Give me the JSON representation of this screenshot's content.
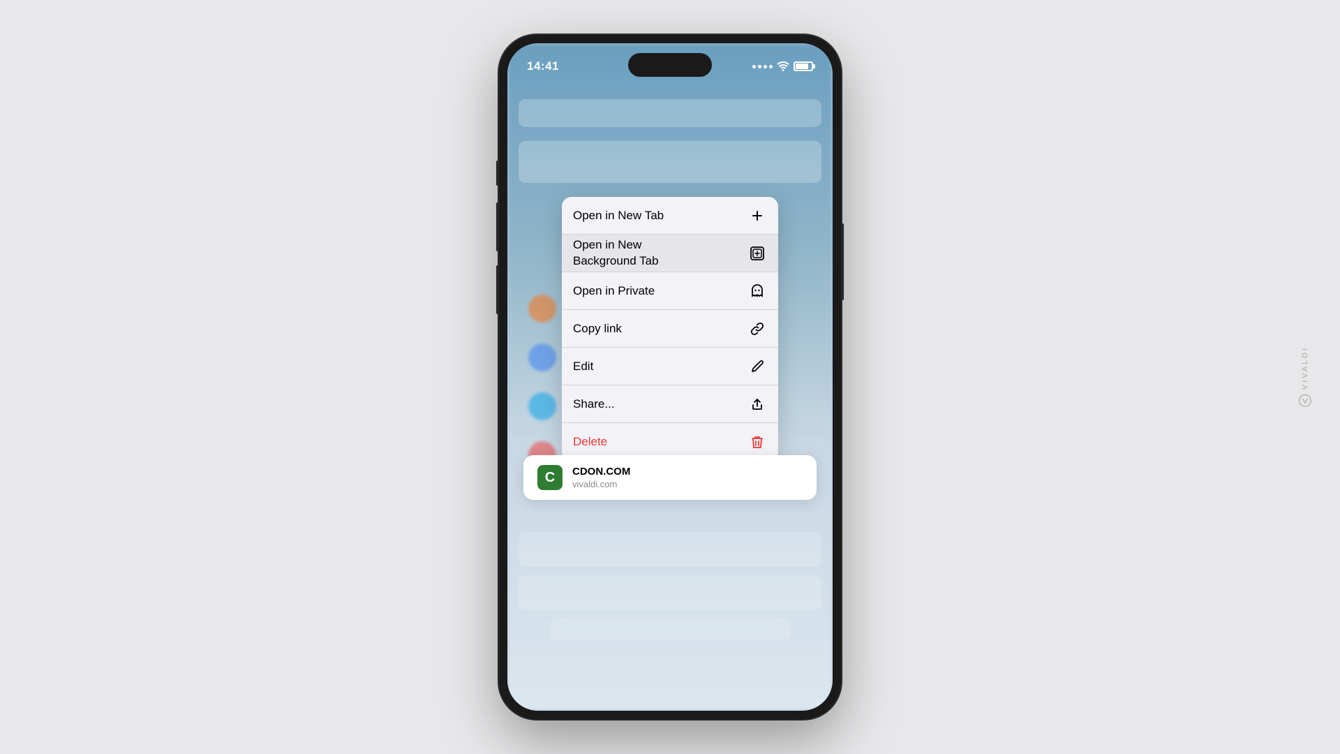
{
  "status_bar": {
    "time": "14:41"
  },
  "context_menu": {
    "items": [
      {
        "id": "open-new-tab",
        "label": "Open in New Tab",
        "icon": "plus",
        "highlighted": false,
        "delete": false
      },
      {
        "id": "open-bg-tab",
        "label": "Open in New\nBackground Tab",
        "icon": "plus-square",
        "highlighted": true,
        "delete": false
      },
      {
        "id": "open-private",
        "label": "Open in Private",
        "icon": "ghost",
        "highlighted": false,
        "delete": false
      },
      {
        "id": "copy-link",
        "label": "Copy link",
        "icon": "link",
        "highlighted": false,
        "delete": false
      },
      {
        "id": "edit",
        "label": "Edit",
        "icon": "pencil",
        "highlighted": false,
        "delete": false
      },
      {
        "id": "share",
        "label": "Share...",
        "icon": "share",
        "highlighted": false,
        "delete": false
      },
      {
        "id": "delete",
        "label": "Delete",
        "icon": "trash",
        "highlighted": false,
        "delete": true
      }
    ]
  },
  "url_card": {
    "favicon_letter": "C",
    "title": "CDON.COM",
    "subtitle": "vivaldi.com"
  },
  "vivaldi": {
    "text": "VIVALDI"
  }
}
